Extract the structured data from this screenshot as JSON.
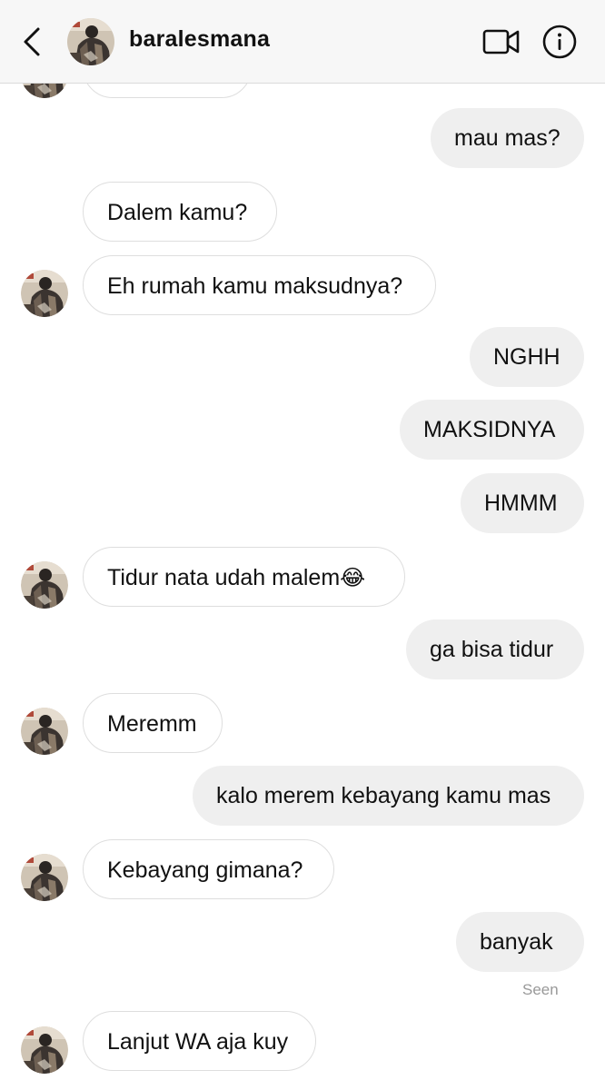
{
  "header": {
    "username": "baralesmana",
    "back_icon": "chevron-left-icon",
    "video_icon": "video-camera-icon",
    "info_icon": "info-circle-icon"
  },
  "messages": [
    {
      "from": "them",
      "text": ""
    },
    {
      "from": "me",
      "text": "mau mas?"
    },
    {
      "from": "them",
      "text": "Dalem kamu?"
    },
    {
      "from": "them",
      "text": "Eh rumah kamu maksudnya?"
    },
    {
      "from": "me",
      "text": "NGHH"
    },
    {
      "from": "me",
      "text": "MAKSIDNYA"
    },
    {
      "from": "me",
      "text": "HMMM"
    },
    {
      "from": "them",
      "text": "Tidur nata udah malem",
      "emoji": "😂"
    },
    {
      "from": "me",
      "text": "ga bisa tidur"
    },
    {
      "from": "them",
      "text": "Meremm"
    },
    {
      "from": "me",
      "text": "kalo merem kebayang kamu mas"
    },
    {
      "from": "them",
      "text": "Kebayang gimana?"
    },
    {
      "from": "me",
      "text": "banyak"
    },
    {
      "from": "them",
      "text": "Lanjut WA aja kuy"
    }
  ],
  "status": {
    "seen": "Seen"
  },
  "colors": {
    "header_bg": "#f7f7f7",
    "outgoing_bubble": "#efefef",
    "incoming_border": "#dedede",
    "muted_text": "#999999"
  }
}
